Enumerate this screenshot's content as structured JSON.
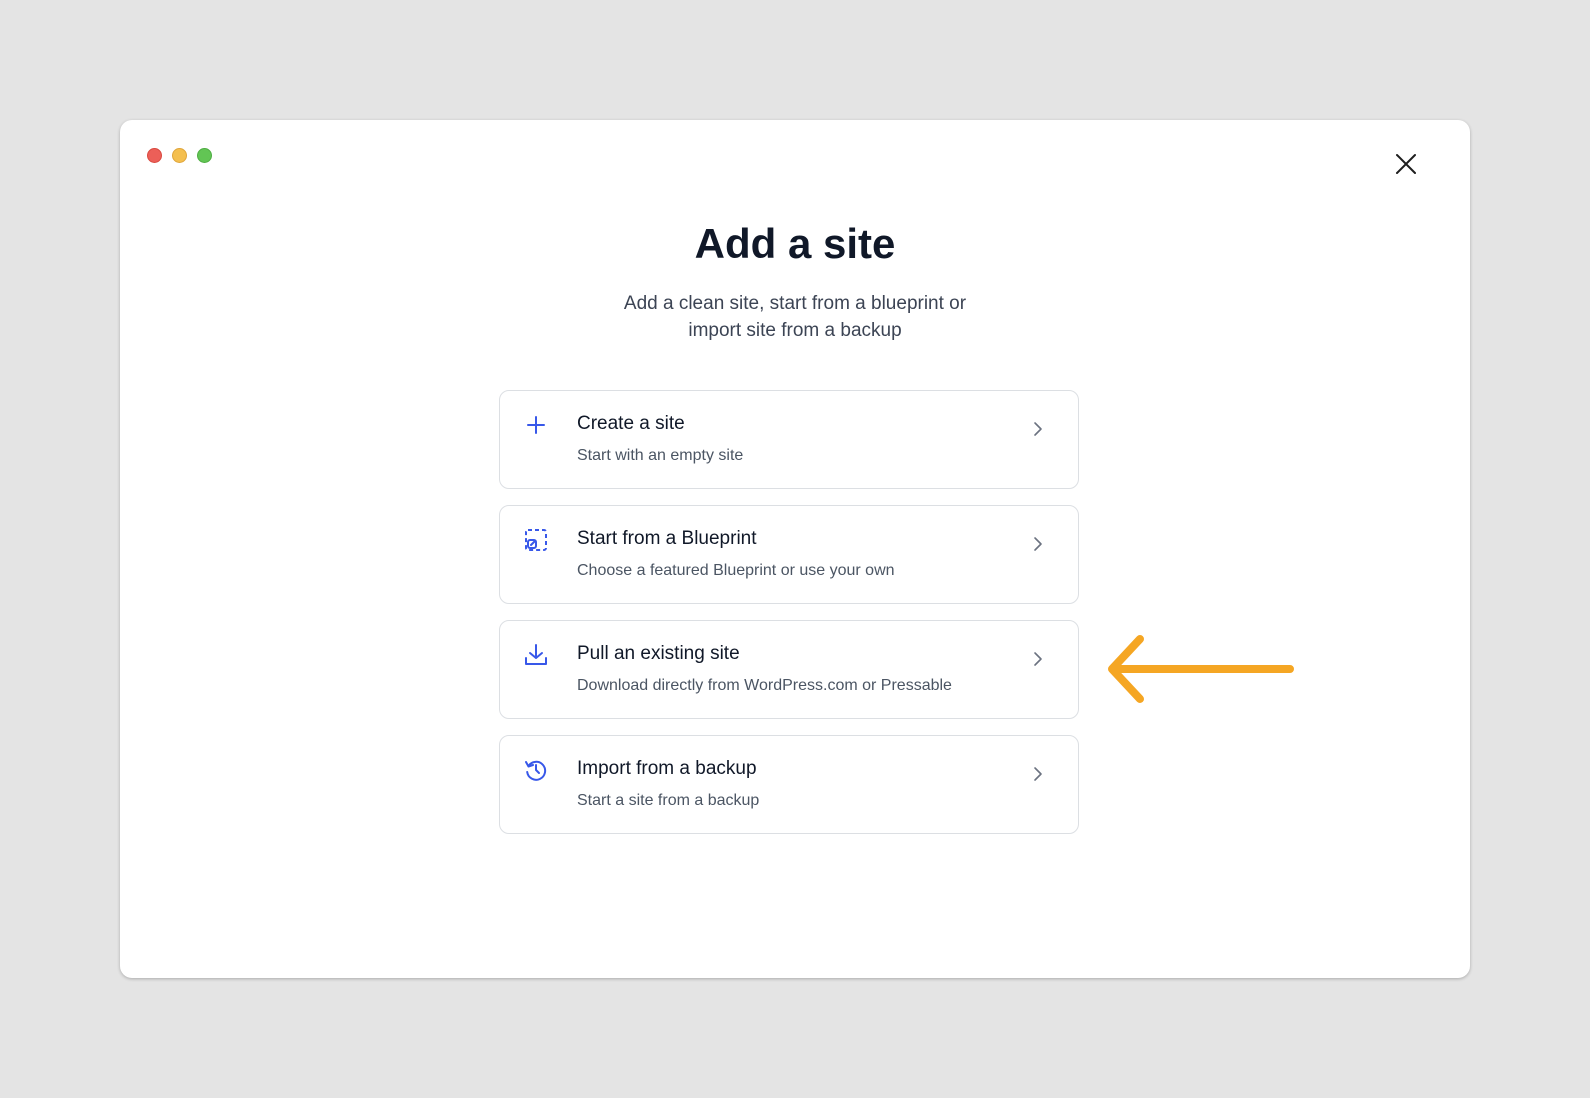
{
  "dialog": {
    "title": "Add a site",
    "subtitle": "Add a clean site, start from a blueprint or import site from a backup"
  },
  "options": [
    {
      "label": "Create a site",
      "description": "Start with an empty site",
      "icon": "plus-icon"
    },
    {
      "label": "Start from a Blueprint",
      "description": "Choose a featured Blueprint or use your own",
      "icon": "blueprint-icon"
    },
    {
      "label": "Pull an existing site",
      "description": "Download directly from WordPress.com or Pressable",
      "icon": "download-icon"
    },
    {
      "label": "Import from a backup",
      "description": "Start a site from a backup",
      "icon": "history-icon"
    }
  ],
  "colors": {
    "accent": "#3858e9",
    "annotation_arrow": "#f5a623"
  }
}
